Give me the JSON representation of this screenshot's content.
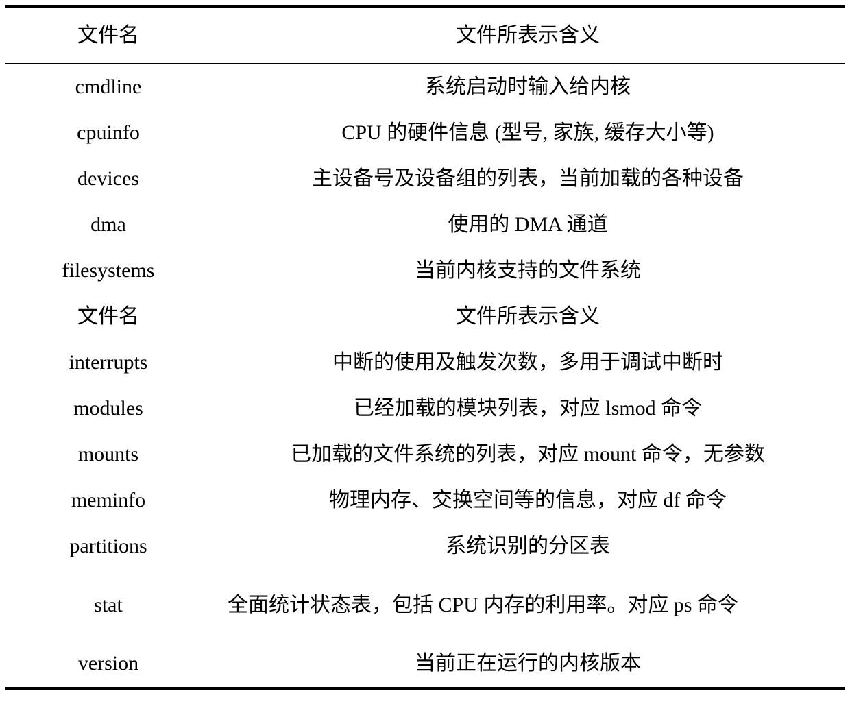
{
  "document": {
    "type": "table",
    "subject": "Linux /proc filesystem file descriptions"
  },
  "table": {
    "columns": [
      {
        "key": "filename",
        "label": "文件名"
      },
      {
        "key": "meaning",
        "label": "文件所表示含义"
      }
    ],
    "rows": [
      {
        "kind": "data",
        "filename": "cmdline",
        "meaning": "系统启动时输入给内核"
      },
      {
        "kind": "data",
        "filename": "cpuinfo",
        "meaning": "CPU 的硬件信息 (型号, 家族, 缓存大小等)"
      },
      {
        "kind": "data",
        "filename": "devices",
        "meaning": "主设备号及设备组的列表，当前加载的各种设备"
      },
      {
        "kind": "data",
        "filename": "dma",
        "meaning": "使用的 DMA 通道"
      },
      {
        "kind": "data",
        "filename": "filesystems",
        "meaning": "当前内核支持的文件系统"
      },
      {
        "kind": "header",
        "filename": "文件名",
        "meaning": "文件所表示含义"
      },
      {
        "kind": "data",
        "filename": "interrupts",
        "meaning": "中断的使用及触发次数，多用于调试中断时"
      },
      {
        "kind": "data",
        "filename": "modules",
        "meaning": "已经加载的模块列表，对应 lsmod 命令"
      },
      {
        "kind": "data",
        "filename": "mounts",
        "meaning": "已加载的文件系统的列表，对应 mount 命令，无参数"
      },
      {
        "kind": "data",
        "filename": "meminfo",
        "meaning": "物理内存、交换空间等的信息，对应 df 命令"
      },
      {
        "kind": "data",
        "filename": "partitions",
        "meaning": "系统识别的分区表"
      },
      {
        "kind": "wrap",
        "filename": "stat",
        "meaning": "全面统计状态表，包括 CPU 内存的利用率。对应 ps 命令"
      },
      {
        "kind": "data",
        "filename": "version",
        "meaning": "当前正在运行的内核版本"
      }
    ]
  },
  "rules": {
    "top": "thick",
    "header_separator": "thin",
    "bottom": "thick",
    "color": "#000000"
  }
}
